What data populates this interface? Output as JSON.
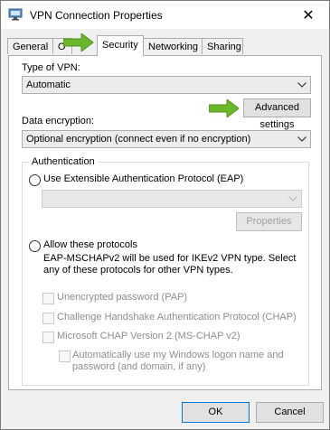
{
  "window": {
    "title": "VPN Connection Properties",
    "close_glyph": "✕"
  },
  "tabs": [
    {
      "label": "General"
    },
    {
      "label": "O"
    },
    {
      "label": "Security"
    },
    {
      "label": "Networking"
    },
    {
      "label": "Sharing"
    }
  ],
  "vpn_type": {
    "label": "Type of VPN:",
    "value": "Automatic",
    "advanced_button": "Advanced settings"
  },
  "encryption": {
    "label": "Data encryption:",
    "value": "Optional encryption (connect even if no encryption)"
  },
  "authentication": {
    "legend": "Authentication",
    "eap_radio": "Use Extensible Authentication Protocol (EAP)",
    "eap_dropdown_value": "",
    "properties_button": "Properties",
    "allow_radio": "Allow these protocols",
    "note_line1": "EAP-MSCHAPv2 will be used for IKEv2 VPN type. Select",
    "note_line2": "any of these protocols for other VPN types.",
    "protocols": [
      {
        "label": "Unencrypted password (PAP)"
      },
      {
        "label": "Challenge Handshake Authentication Protocol (CHAP)"
      },
      {
        "label": "Microsoft CHAP Version 2 (MS-CHAP v2)"
      }
    ],
    "auto_logon_line1": "Automatically use my Windows logon name and",
    "auto_logon_line2": "password (and domain, if any)"
  },
  "footer": {
    "ok": "OK",
    "cancel": "Cancel"
  },
  "colors": {
    "arrow_green": "#6ab82a",
    "focus_blue": "#0078d7"
  }
}
